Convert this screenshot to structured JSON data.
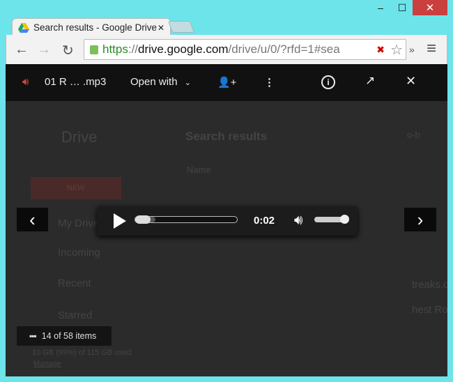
{
  "window": {
    "minimize": "‒",
    "maximize": "☐",
    "close": "✕"
  },
  "tab": {
    "title": "Search results - Google Drive",
    "close": "✕"
  },
  "toolbar": {
    "back": "←",
    "forward": "→",
    "reload": "↻",
    "url_scheme": "https",
    "url_sep": "://",
    "url_host": "drive.google.com",
    "url_path": "/drive/u/0/?rfd=1#sea",
    "star": "☆",
    "more": "»",
    "menu": "≡"
  },
  "background": {
    "app": "Drive",
    "heading": "Search results",
    "column": "Name",
    "new_button": "NEW",
    "nav": [
      "My Drive",
      "Incoming",
      "Recent",
      "Starred"
    ],
    "storage": "10 GB (99%) of 115 GB used",
    "manage": "Manage",
    "right_texts": [
      "o-b",
      "treaks.c",
      "hest Ro"
    ]
  },
  "viewer": {
    "file_name": "01 R … .mp3",
    "open_with": "Open with",
    "prev": "‹",
    "next": "›",
    "time": "0:02",
    "progress": 0.1,
    "volume": 1.0,
    "count": "14 of 58 items"
  },
  "colors": {
    "accent_red": "#e0463a"
  }
}
